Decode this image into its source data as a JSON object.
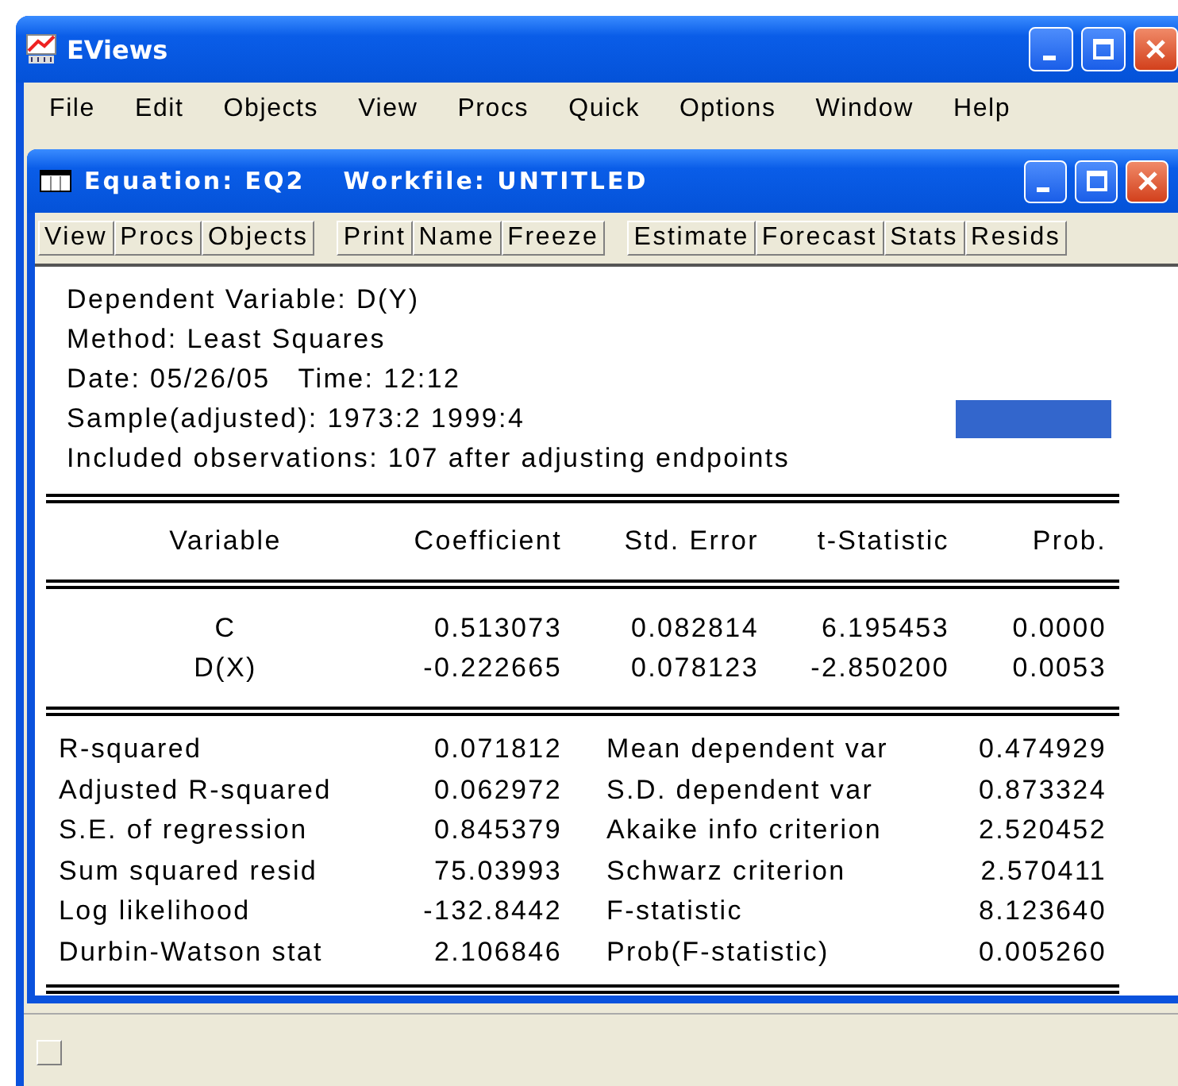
{
  "window": {
    "title": "EViews"
  },
  "menu": [
    "File",
    "Edit",
    "Objects",
    "View",
    "Procs",
    "Quick",
    "Options",
    "Window",
    "Help"
  ],
  "child_window": {
    "title": "Equation: EQ2",
    "workfile": "Workfile: UNTITLED"
  },
  "toolbar": [
    {
      "buttons": [
        "View",
        "Procs",
        "Objects"
      ]
    },
    {
      "buttons": [
        "Print",
        "Name",
        "Freeze"
      ]
    },
    {
      "buttons": [
        "Estimate",
        "Forecast",
        "Stats",
        "Resids"
      ]
    }
  ],
  "header_lines": [
    {
      "text": "Dependent Variable: D(Y)",
      "marked": false
    },
    {
      "text": "Method: Least Squares",
      "marked": false
    },
    {
      "text": "Date: 05/26/05   Time: 12:12",
      "marked": false
    },
    {
      "text": "Sample(adjusted): 1973:2 1999:4",
      "marked": true
    },
    {
      "text": "Included observations: 107 after adjusting endpoints",
      "marked": false
    }
  ],
  "table": {
    "columns": [
      "Variable",
      "Coefficient",
      "Std. Error",
      "t-Statistic",
      "Prob."
    ],
    "rows": [
      [
        "C",
        "0.513073",
        "0.082814",
        "6.195453",
        "0.0000"
      ],
      [
        "D(X)",
        "-0.222665",
        "0.078123",
        "-2.850200",
        "0.0053"
      ]
    ]
  },
  "stats": [
    [
      "R-squared",
      "0.071812",
      "Mean dependent var",
      "0.474929"
    ],
    [
      "Adjusted R-squared",
      "0.062972",
      "S.D. dependent var",
      "0.873324"
    ],
    [
      "S.E. of regression",
      "0.845379",
      "Akaike info criterion",
      "2.520452"
    ],
    [
      "Sum squared resid",
      "75.03993",
      "Schwarz criterion",
      "2.570411"
    ],
    [
      "Log likelihood",
      "-132.8442",
      "F-statistic",
      "8.123640"
    ],
    [
      "Durbin-Watson stat",
      "2.106846",
      "Prob(F-statistic)",
      "0.005260"
    ]
  ]
}
